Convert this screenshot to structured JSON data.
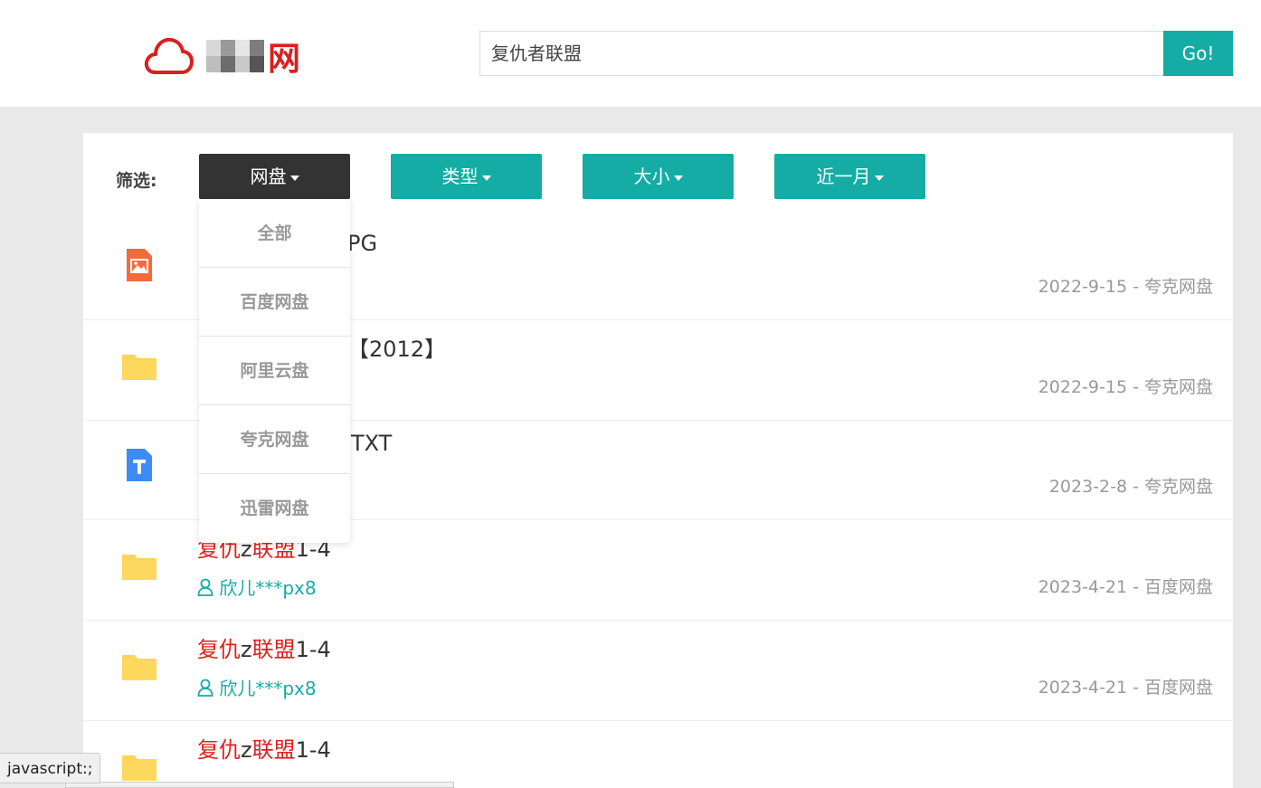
{
  "header": {
    "logo_text": "网",
    "search_value": "复仇者联盟",
    "search_button": "Go!"
  },
  "filters": {
    "label": "筛选:",
    "buttons": [
      {
        "label": "网盘",
        "active": true
      },
      {
        "label": "类型"
      },
      {
        "label": "大小"
      },
      {
        "label": "近一月"
      }
    ],
    "dropdown_items": [
      "全部",
      "百度网盘",
      "阿里云盘",
      "夸克网盘",
      "迅雷网盘"
    ]
  },
  "results": [
    {
      "icon": "image-file-icon",
      "title_pre": "",
      "title_hl1": "",
      "title_mid": "",
      "title_hl2": "",
      "title_post": "PG",
      "user": "",
      "meta": "2022-9-15 - 夸克网盘"
    },
    {
      "icon": "folder-icon",
      "title_pre": "",
      "title_hl1": "",
      "title_mid": "",
      "title_hl2": "",
      "title_post": "【2012】",
      "user": "",
      "meta": "2022-9-15 - 夸克网盘"
    },
    {
      "icon": "text-file-icon",
      "title_pre": "",
      "title_hl1": "",
      "title_mid": "",
      "title_hl2": "",
      "title_post": "TXT",
      "user": "",
      "meta": "2023-2-8 - 夸克网盘"
    },
    {
      "icon": "folder-icon",
      "title_hl1": "复仇",
      "title_mid": "z",
      "title_hl2": "联盟",
      "title_post": "1-4",
      "user": "欣儿***px8",
      "meta": "2023-4-21 - 百度网盘"
    },
    {
      "icon": "folder-icon",
      "title_hl1": "复仇",
      "title_mid": "z",
      "title_hl2": "联盟",
      "title_post": "1-4",
      "user": "欣儿***px8",
      "meta": "2023-4-21 - 百度网盘"
    },
    {
      "icon": "folder-icon",
      "title_hl1": "复仇",
      "title_mid": "z",
      "title_hl2": "联盟",
      "title_post": "1-4",
      "user": "",
      "meta": ""
    }
  ],
  "status_bar": "javascript:;",
  "colors": {
    "accent": "#14aca4",
    "active": "#333333",
    "highlight": "#e0201c",
    "logo": "#d9201f"
  }
}
